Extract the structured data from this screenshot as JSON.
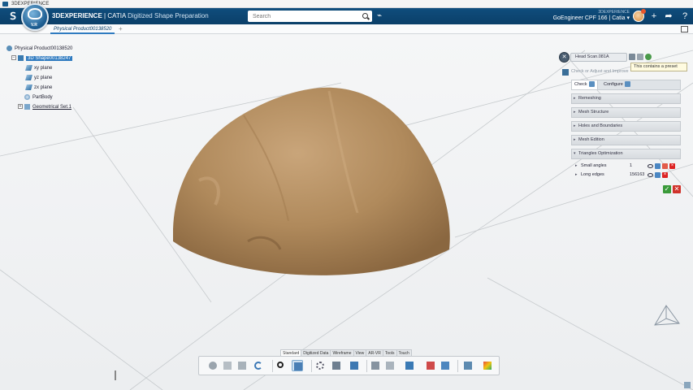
{
  "titlebar": {
    "title": "3DEXPERIENCE"
  },
  "topbar": {
    "brand_bold": "3DEXPERIENCE",
    "brand_app": " | CATIA ",
    "brand_sub": "Digitized Shape Preparation",
    "search_placeholder": "Search",
    "user_small": "3DEXPERIENCE",
    "user_name": "GoEngineer CPF 166 | Catia ▾",
    "logo_glyph": "ꓢ",
    "compass_label": "V.R"
  },
  "tabs": {
    "active_label": "Physical Product00138520",
    "add_label": "+"
  },
  "tree": {
    "items": [
      {
        "label": "Physical Product00138520",
        "icon": "product-icon"
      },
      {
        "label": "3D Shape00138247",
        "icon": "shape-icon"
      },
      {
        "label": "xy plane",
        "icon": "plane-icon"
      },
      {
        "label": "yz plane",
        "icon": "plane-icon"
      },
      {
        "label": "zx plane",
        "icon": "plane-icon"
      },
      {
        "label": "PartBody",
        "icon": "partbody-icon"
      },
      {
        "label": "Geometrical Set.1",
        "icon": "geometrical-set-icon"
      }
    ]
  },
  "panel": {
    "mesh_name": "Head Scan.081A",
    "tooltip": "This contains a preset",
    "check_placeholder": "Check or Adjust and Improve",
    "tab_check": "Check",
    "tab_configure": "Configure",
    "sections": [
      {
        "label": "Remeshing",
        "open": false
      },
      {
        "label": "Mesh Structure",
        "open": false
      },
      {
        "label": "Holes and Boundaries",
        "open": false
      },
      {
        "label": "Mesh Edition",
        "open": false
      },
      {
        "label": "Triangles Optimization",
        "open": true
      }
    ],
    "rows": [
      {
        "label": "Small angles",
        "value": "1"
      },
      {
        "label": "Long edges",
        "value": "156163"
      }
    ],
    "ok_glyph": "✓",
    "cancel_glyph": "✕"
  },
  "section_tabs": [
    "Standard",
    "Digitized Data",
    "Wireframe",
    "View",
    "AR-VR",
    "Tools",
    "Touch"
  ],
  "colors": {
    "top_bar": "#0f4d7d",
    "accent": "#2f7bc0",
    "shape": "#b08a5c",
    "ok": "#3a9a3a",
    "cancel": "#d0332b"
  }
}
